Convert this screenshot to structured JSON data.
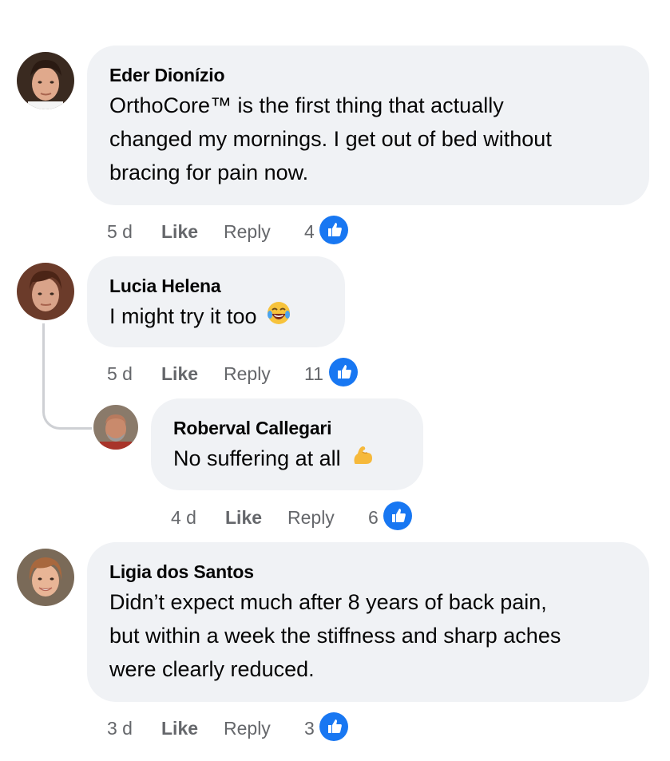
{
  "comments": [
    {
      "author": "Eder Dionízio",
      "lines": [
        "OrthoCore™ is the first thing that actually",
        "changed my mornings. I get out of bed without",
        "bracing for pain now."
      ],
      "time": "5 d",
      "like_label": "Like",
      "reply_label": "Reply",
      "reaction_count": "4"
    },
    {
      "author": "Lucia Helena",
      "text": "I might try it too",
      "emoji": "laughing-tears-emoji",
      "time": "5 d",
      "like_label": "Like",
      "reply_label": "Reply",
      "reaction_count": "11"
    },
    {
      "author": "Roberval Callegari",
      "text": "No suffering at all",
      "emoji": "flexed-biceps-emoji",
      "time": "4 d",
      "like_label": "Like",
      "reply_label": "Reply",
      "reaction_count": "6"
    },
    {
      "author": "Ligia dos Santos",
      "lines": [
        "Didn’t expect much after 8 years of back pain,",
        "but within a week the stiffness and sharp aches",
        "were clearly reduced."
      ],
      "time": "3 d",
      "like_label": "Like",
      "reply_label": "Reply",
      "reaction_count": "3"
    }
  ],
  "colors": {
    "bubble": "#f0f2f5",
    "meta_text": "#65676b",
    "like_blue": "#1877f2",
    "thread_line": "#ced0d4"
  }
}
